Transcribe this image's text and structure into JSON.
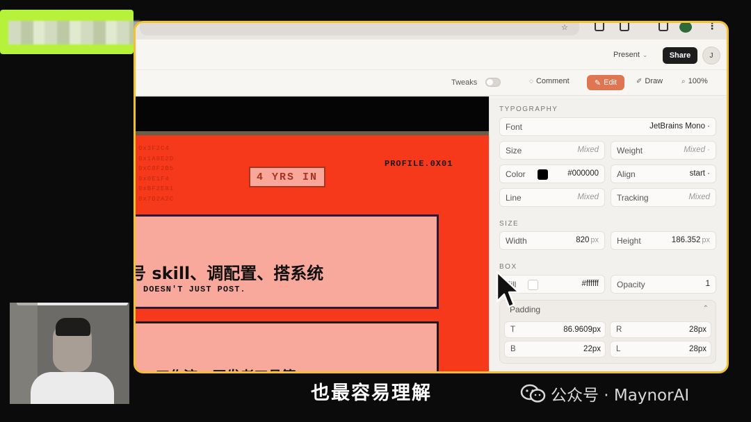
{
  "toolbar": {
    "present_label": "Present",
    "share_label": "Share",
    "avatar_initial": "J",
    "tweaks_label": "Tweaks",
    "comment_label": "Comment",
    "edit_label": "Edit",
    "draw_label": "Draw",
    "zoom_label": "100%"
  },
  "canvas": {
    "hex_lines": [
      "0x3F2C4",
      "0x1A9E2D",
      "0xC8F2B5",
      "0x0E1F4",
      "0xBF2E81",
      "0x7D2A2C"
    ],
    "yrs_tag": "4 YRS IN",
    "profile_id": "PROFILE.0X01",
    "card1_title": "号 skill、调配置、搭系统",
    "card1_sub": "DOESN'T JUST POST.",
    "card2_title": "工作流 · 开发者工具等"
  },
  "panel": {
    "typography": {
      "section_label": "TYPOGRAPHY",
      "font_label": "Font",
      "font_value": "JetBrains Mono ·",
      "size_label": "Size",
      "size_value": "Mixed",
      "weight_label": "Weight",
      "weight_value": "Mixed ·",
      "color_label": "Color",
      "color_value": "#000000",
      "align_label": "Align",
      "align_value": "start ·",
      "line_label": "Line",
      "line_value": "Mixed",
      "tracking_label": "Tracking",
      "tracking_value": "Mixed"
    },
    "size": {
      "section_label": "SIZE",
      "width_label": "Width",
      "width_value": "820",
      "height_label": "Height",
      "height_value": "186.352",
      "unit": "px"
    },
    "box": {
      "section_label": "BOX",
      "fill_label": "Fill",
      "fill_value": "#ffffff",
      "opacity_label": "Opacity",
      "opacity_value": "1",
      "padding_label": "Padding",
      "t_label": "T",
      "t_value": "86.9609",
      "r_label": "R",
      "r_value": "28",
      "b_label": "B",
      "b_value": "22",
      "l_label": "L",
      "l_value": "28",
      "unit": "px"
    }
  },
  "overlay": {
    "subtitle": "也最容易理解",
    "watermark": "公众号 · MaynorAI"
  },
  "colors": {
    "window_border": "#f2c132",
    "canvas_red": "#f5391a",
    "card_pink": "#f9a89c",
    "edit_accent": "#e07552",
    "green_tag": "#b6f23a"
  }
}
